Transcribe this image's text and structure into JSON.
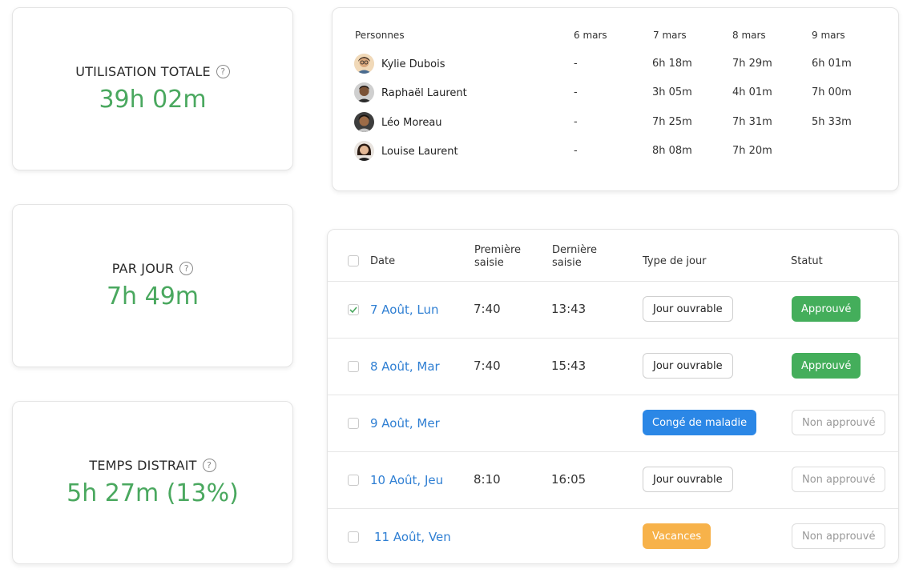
{
  "stats": [
    {
      "label": "UTILISATION TOTALE",
      "value": "39h 02m"
    },
    {
      "label": "PAR JOUR",
      "value": "7h 49m"
    },
    {
      "label": "TEMPS DISTRAIT",
      "value": "5h 27m (13%)"
    }
  ],
  "help_glyph": "?",
  "people_table": {
    "header_person": "Personnes",
    "dates": [
      "6 mars",
      "7 mars",
      "8 mars",
      "9 mars"
    ],
    "rows": [
      {
        "name": "Kylie Dubois",
        "cells": [
          "-",
          "6h 18m",
          "7h 29m",
          "6h 01m"
        ]
      },
      {
        "name": "Raphaël Laurent",
        "cells": [
          "-",
          "3h 05m",
          "4h 01m",
          "7h 00m"
        ]
      },
      {
        "name": "Léo Moreau",
        "cells": [
          "-",
          "7h 25m",
          "7h 31m",
          "5h 33m"
        ]
      },
      {
        "name": "Louise Laurent",
        "cells": [
          "-",
          "8h 08m",
          "7h 20m",
          ""
        ]
      }
    ]
  },
  "leave_table": {
    "headers": {
      "date": "Date",
      "first_line1": "Première",
      "first_line2": "saisie",
      "last_line1": "Dernière",
      "last_line2": "saisie",
      "type": "Type de jour",
      "status": "Statut"
    },
    "rows": [
      {
        "date": "7 Août, Lun",
        "first": "7:40",
        "last": "13:43",
        "type": "Jour ouvrable",
        "status": "Approuvé",
        "checked": true
      },
      {
        "date": "8 Août, Mar",
        "first": "7:40",
        "last": "15:43",
        "type": "Jour ouvrable",
        "status": "Approuvé",
        "checked": false
      },
      {
        "date": "9 Août, Mer",
        "first": "",
        "last": "",
        "type": "Congé de maladie",
        "status": "Non approuvé",
        "checked": false
      },
      {
        "date": "10 Août, Jeu",
        "first": "8:10",
        "last": "16:05",
        "type": "Jour ouvrable",
        "status": "Non approuvé",
        "checked": false
      },
      {
        "date": "11 Août, Ven",
        "first": "",
        "last": "",
        "type": "Vacances",
        "status": "Non approuvé",
        "checked": false
      }
    ]
  },
  "colors": {
    "accent_green": "#4aa85f",
    "link_blue": "#2f7fd3",
    "approved": "#44ae5b",
    "sick_leave": "#2b87e6",
    "vacation": "#f7b24a"
  }
}
